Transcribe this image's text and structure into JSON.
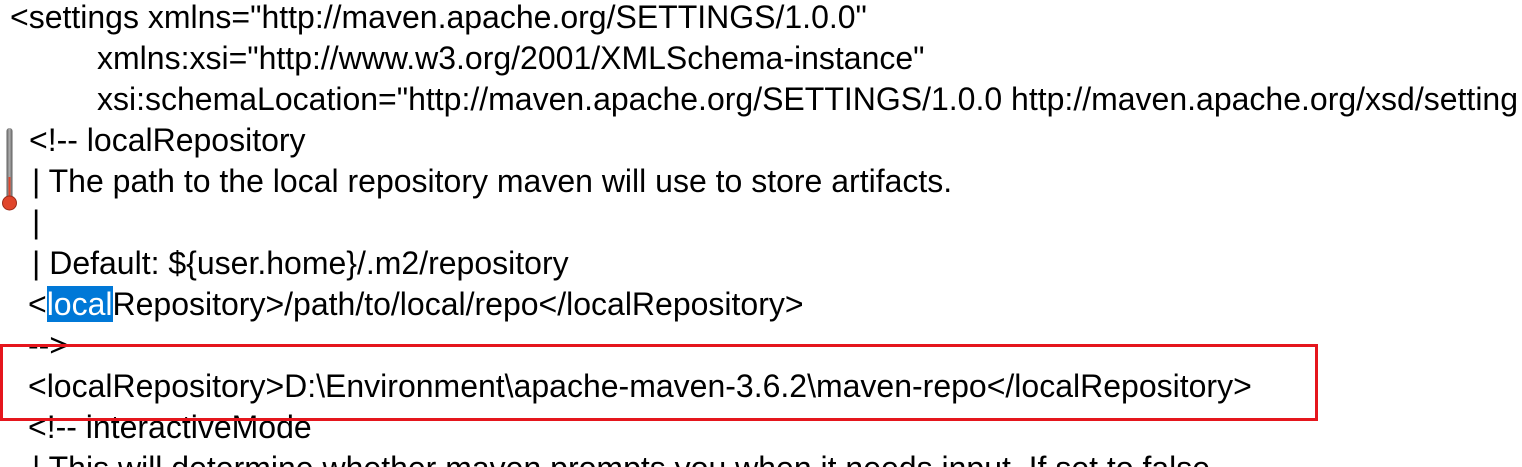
{
  "editor": {
    "lines": [
      {
        "text": "<settings xmlns=\"http://maven.apache.org/SETTINGS/1.0.0\""
      },
      {
        "text": "xmlns:xsi=\"http://www.w3.org/2001/XMLSchema-instance\""
      },
      {
        "text": "xsi:schemaLocation=\"http://maven.apache.org/SETTINGS/1.0.0 http://maven.apache.org/xsd/setting"
      },
      {
        "text": "<!-- localRepository"
      },
      {
        "text": "| The path to the local repository maven will use to store artifacts."
      },
      {
        "text": "|"
      },
      {
        "text": "| Default: ${user.home}/.m2/repository"
      },
      {
        "before": "<",
        "selected": "local",
        "after": "Repository>/path/to/local/repo</localRepository>"
      },
      {
        "text": "-->"
      },
      {
        "text": "<localRepository>D:\\Environment\\apache-maven-3.6.2\\maven-repo</localRepository>"
      },
      {
        "text": "<!-- interactiveMode"
      },
      {
        "text": "| This will determine whether maven prompts you when it needs input. If set to false"
      }
    ]
  },
  "icons": {
    "gutter_marker": "thermometer-icon"
  },
  "colors": {
    "background": "#FFFFFF",
    "text": "#000000",
    "selection_bg": "#0078D7",
    "selection_fg": "#FFFFFF",
    "annotation_box": "#E5161D",
    "marker_bulb": "#E0452B"
  }
}
